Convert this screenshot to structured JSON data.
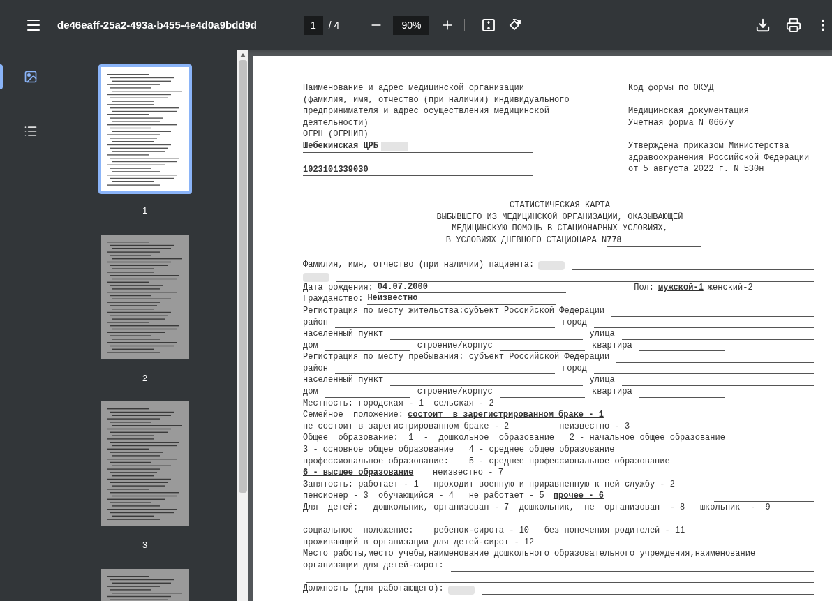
{
  "toolbar": {
    "title": "de46eaff-25a2-493a-b455-4e4d0a9bdd9d",
    "page": "1",
    "page_total": "/ 4",
    "zoom": "90%"
  },
  "sidebar": {
    "views": [
      {
        "kind": "thumbnails",
        "selected": true
      },
      {
        "kind": "outline",
        "selected": false
      }
    ],
    "thumbnails": [
      {
        "label": "1",
        "selected": true
      },
      {
        "label": "2",
        "selected": false
      },
      {
        "label": "3",
        "selected": false
      },
      {
        "selected": false
      }
    ]
  },
  "document": {
    "header_left": {
      "lines": [
        "Наименование и адрес медицинской организации",
        "(фамилия, имя, отчество (при наличии) индивидуального",
        "предпринимателя и адрес осуществления медицинской",
        "деятельности)",
        "ОГРН (ОГРНИП)"
      ],
      "organization": "Шебекинская ЦРБ",
      "ogrn": "1023101339030"
    },
    "header_right": {
      "okud_label": "Код формы по ОКУД",
      "blocks": [
        [
          "Медицинская документация",
          "Учетная форма N 066/у"
        ],
        [
          "Утверждена приказом Министерства",
          "здравоохранения Российской Федерации",
          "от 5 августа 2022 г. N 530н"
        ]
      ]
    },
    "title": {
      "lines": [
        "СТАТИСТИЧЕСКАЯ КАРТА",
        "ВЫБЫВШЕГО ИЗ МЕДИЦИНСКОЙ ОРГАНИЗАЦИИ, ОКАЗЫВАЮЩЕЙ",
        "МЕДИЦИНСКУЮ ПОМОЩЬ В СТАЦИОНАРНЫХ УСЛОВИЯХ,"
      ],
      "last_line": "В УСЛОВИЯХ ДНЕВНОГО СТАЦИОНАРА N",
      "number": "778"
    },
    "form_lines": [
      {
        "segments": [
          {
            "kind": "text",
            "text": "Фамилия, имя, отчество (при наличии) пациента:"
          },
          {
            "kind": "redacted"
          },
          {
            "kind": "blank"
          }
        ]
      },
      {
        "segments": [
          {
            "kind": "redacted"
          },
          {
            "kind": "blank"
          }
        ]
      },
      {
        "segments": [
          {
            "kind": "text",
            "text": "Дата рождения:"
          },
          {
            "kind": "value",
            "text": "04.07.2000"
          },
          {
            "kind": "space"
          },
          {
            "kind": "text",
            "text": "Пол:"
          },
          {
            "kind": "chosen",
            "text": "мужской-1"
          },
          {
            "kind": "text",
            "text": "женский-2"
          },
          {
            "kind": "space"
          }
        ]
      },
      {
        "segments": [
          {
            "kind": "text",
            "text": "Гражданство:"
          },
          {
            "kind": "value",
            "text": "Неизвестно"
          }
        ]
      },
      {
        "segments": [
          {
            "kind": "text",
            "text": "Регистрация по месту жительства:субъект Российской Федерации"
          },
          {
            "kind": "blank"
          }
        ]
      },
      {
        "segments": [
          {
            "kind": "text",
            "text": "район"
          },
          {
            "kind": "blank"
          },
          {
            "kind": "text",
            "text": "город"
          },
          {
            "kind": "blank"
          }
        ]
      },
      {
        "segments": [
          {
            "kind": "text",
            "text": "населенный пункт"
          },
          {
            "kind": "blank"
          },
          {
            "kind": "text",
            "text": "улица"
          },
          {
            "kind": "blank"
          }
        ]
      },
      {
        "segments": [
          {
            "kind": "text",
            "text": "дом"
          },
          {
            "kind": "blank"
          },
          {
            "kind": "text",
            "text": "строение/корпус"
          },
          {
            "kind": "blank"
          },
          {
            "kind": "text",
            "text": "квартира"
          },
          {
            "kind": "blank"
          },
          {
            "kind": "space"
          }
        ]
      },
      {
        "segments": [
          {
            "kind": "text",
            "text": "Регистрация по месту пребывания: субъект Российской Федерации"
          },
          {
            "kind": "blank"
          }
        ]
      },
      {
        "segments": [
          {
            "kind": "text",
            "text": "район"
          },
          {
            "kind": "blank"
          },
          {
            "kind": "text",
            "text": "город"
          },
          {
            "kind": "blank"
          }
        ]
      },
      {
        "segments": [
          {
            "kind": "text",
            "text": "населенный пункт"
          },
          {
            "kind": "blank"
          },
          {
            "kind": "text",
            "text": "улица"
          },
          {
            "kind": "blank"
          }
        ]
      },
      {
        "segments": [
          {
            "kind": "text",
            "text": "дом"
          },
          {
            "kind": "blank"
          },
          {
            "kind": "text",
            "text": "строение/корпус"
          },
          {
            "kind": "blank"
          },
          {
            "kind": "text",
            "text": "квартира"
          },
          {
            "kind": "blank"
          },
          {
            "kind": "space"
          }
        ]
      },
      {
        "segments": [
          {
            "kind": "text",
            "text": "Местность: городская - 1  сельская - 2"
          }
        ]
      },
      {
        "segments": [
          {
            "kind": "text",
            "text": "Семейное  положение:"
          },
          {
            "kind": "chosen",
            "text": "состоит  в зарегистрированном браке - 1"
          }
        ]
      },
      {
        "segments": [
          {
            "kind": "text",
            "text": "не состоит в зарегистрированном браке - 2          неизвестно - 3"
          }
        ]
      },
      {
        "segments": [
          {
            "kind": "text",
            "text": "Общее  образование:  1  -  дошкольное  образование   2 - начальное общее образование"
          }
        ]
      },
      {
        "segments": [
          {
            "kind": "text",
            "text": "3 - основное общее образование   4 - среднее общее образование"
          }
        ]
      },
      {
        "segments": [
          {
            "kind": "text",
            "text": "профессиональное образование:    5 - среднее профессиональное образование"
          }
        ]
      },
      {
        "segments": [
          {
            "kind": "chosen",
            "text": "6 - высшее образование"
          },
          {
            "kind": "text",
            "text": "   неизвестно - 7"
          }
        ]
      },
      {
        "segments": [
          {
            "kind": "text",
            "text": "Занятость: работает - 1   проходит военную и приравненную к ней службу - 2"
          }
        ]
      },
      {
        "segments": [
          {
            "kind": "text",
            "text": "пенсионер - 3  обучающийся - 4   не работает - 5 "
          },
          {
            "kind": "chosen",
            "text": "прочее - 6"
          },
          {
            "kind": "space"
          },
          {
            "kind": "blank"
          }
        ]
      },
      {
        "segments": [
          {
            "kind": "text",
            "text": "Для  детей:   дошкольник, организован - 7  дошкольник,  не  организован  - 8   школьник  -  9"
          }
        ]
      },
      {
        "spaced": true,
        "segments": [
          {
            "kind": "text",
            "text": "социальное  положение:    ребенок-сирота - 10   без попечения родителей - 11"
          }
        ]
      },
      {
        "segments": [
          {
            "kind": "text",
            "text": "проживающий в организации для детей-сирот - 12"
          }
        ]
      },
      {
        "segments": [
          {
            "kind": "text",
            "text": "Место работы,место учебы,наименование дошкольного образовательного учреждения,наименование"
          }
        ]
      },
      {
        "segments": [
          {
            "kind": "text",
            "text": "организации для детей-сирот:"
          },
          {
            "kind": "blank"
          }
        ]
      },
      {
        "segments": [
          {
            "kind": "blank"
          }
        ]
      },
      {
        "segments": [
          {
            "kind": "text",
            "text": "Должность (для работающего):"
          },
          {
            "kind": "redacted"
          },
          {
            "kind": "blank"
          }
        ]
      }
    ]
  }
}
